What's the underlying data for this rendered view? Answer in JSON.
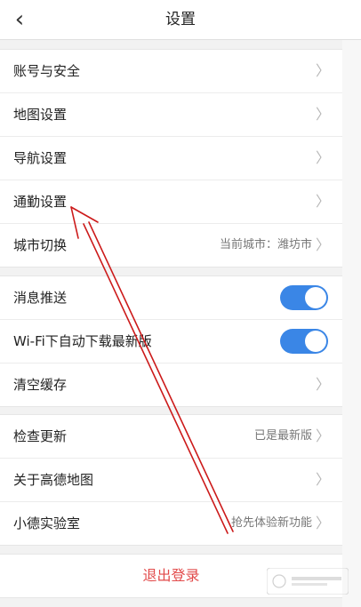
{
  "header": {
    "title": "设置",
    "back_icon": "‹"
  },
  "groups": [
    {
      "items": [
        {
          "label": "账号与安全",
          "value": ""
        },
        {
          "label": "地图设置",
          "value": ""
        },
        {
          "label": "导航设置",
          "value": ""
        },
        {
          "label": "通勤设置",
          "value": ""
        },
        {
          "label": "城市切换",
          "value": "当前城市：潍坊市"
        }
      ]
    },
    {
      "items": [
        {
          "label": "消息推送",
          "toggle": true
        },
        {
          "label": "Wi-Fi下自动下载最新版",
          "toggle": true
        },
        {
          "label": "清空缓存",
          "value": ""
        }
      ]
    },
    {
      "items": [
        {
          "label": "检查更新",
          "value": "已是最新版"
        },
        {
          "label": "关于高德地图",
          "value": ""
        },
        {
          "label": "小德实验室",
          "value": "抢先体验新功能"
        }
      ]
    }
  ],
  "logout": {
    "label": "退出登录"
  },
  "colors": {
    "toggle_on": "#3a86e6",
    "logout_text": "#e24b4b",
    "arrow": "#cc1a1a"
  },
  "icons": {
    "back": "chevron-left-icon",
    "row": "chevron-right-icon"
  }
}
